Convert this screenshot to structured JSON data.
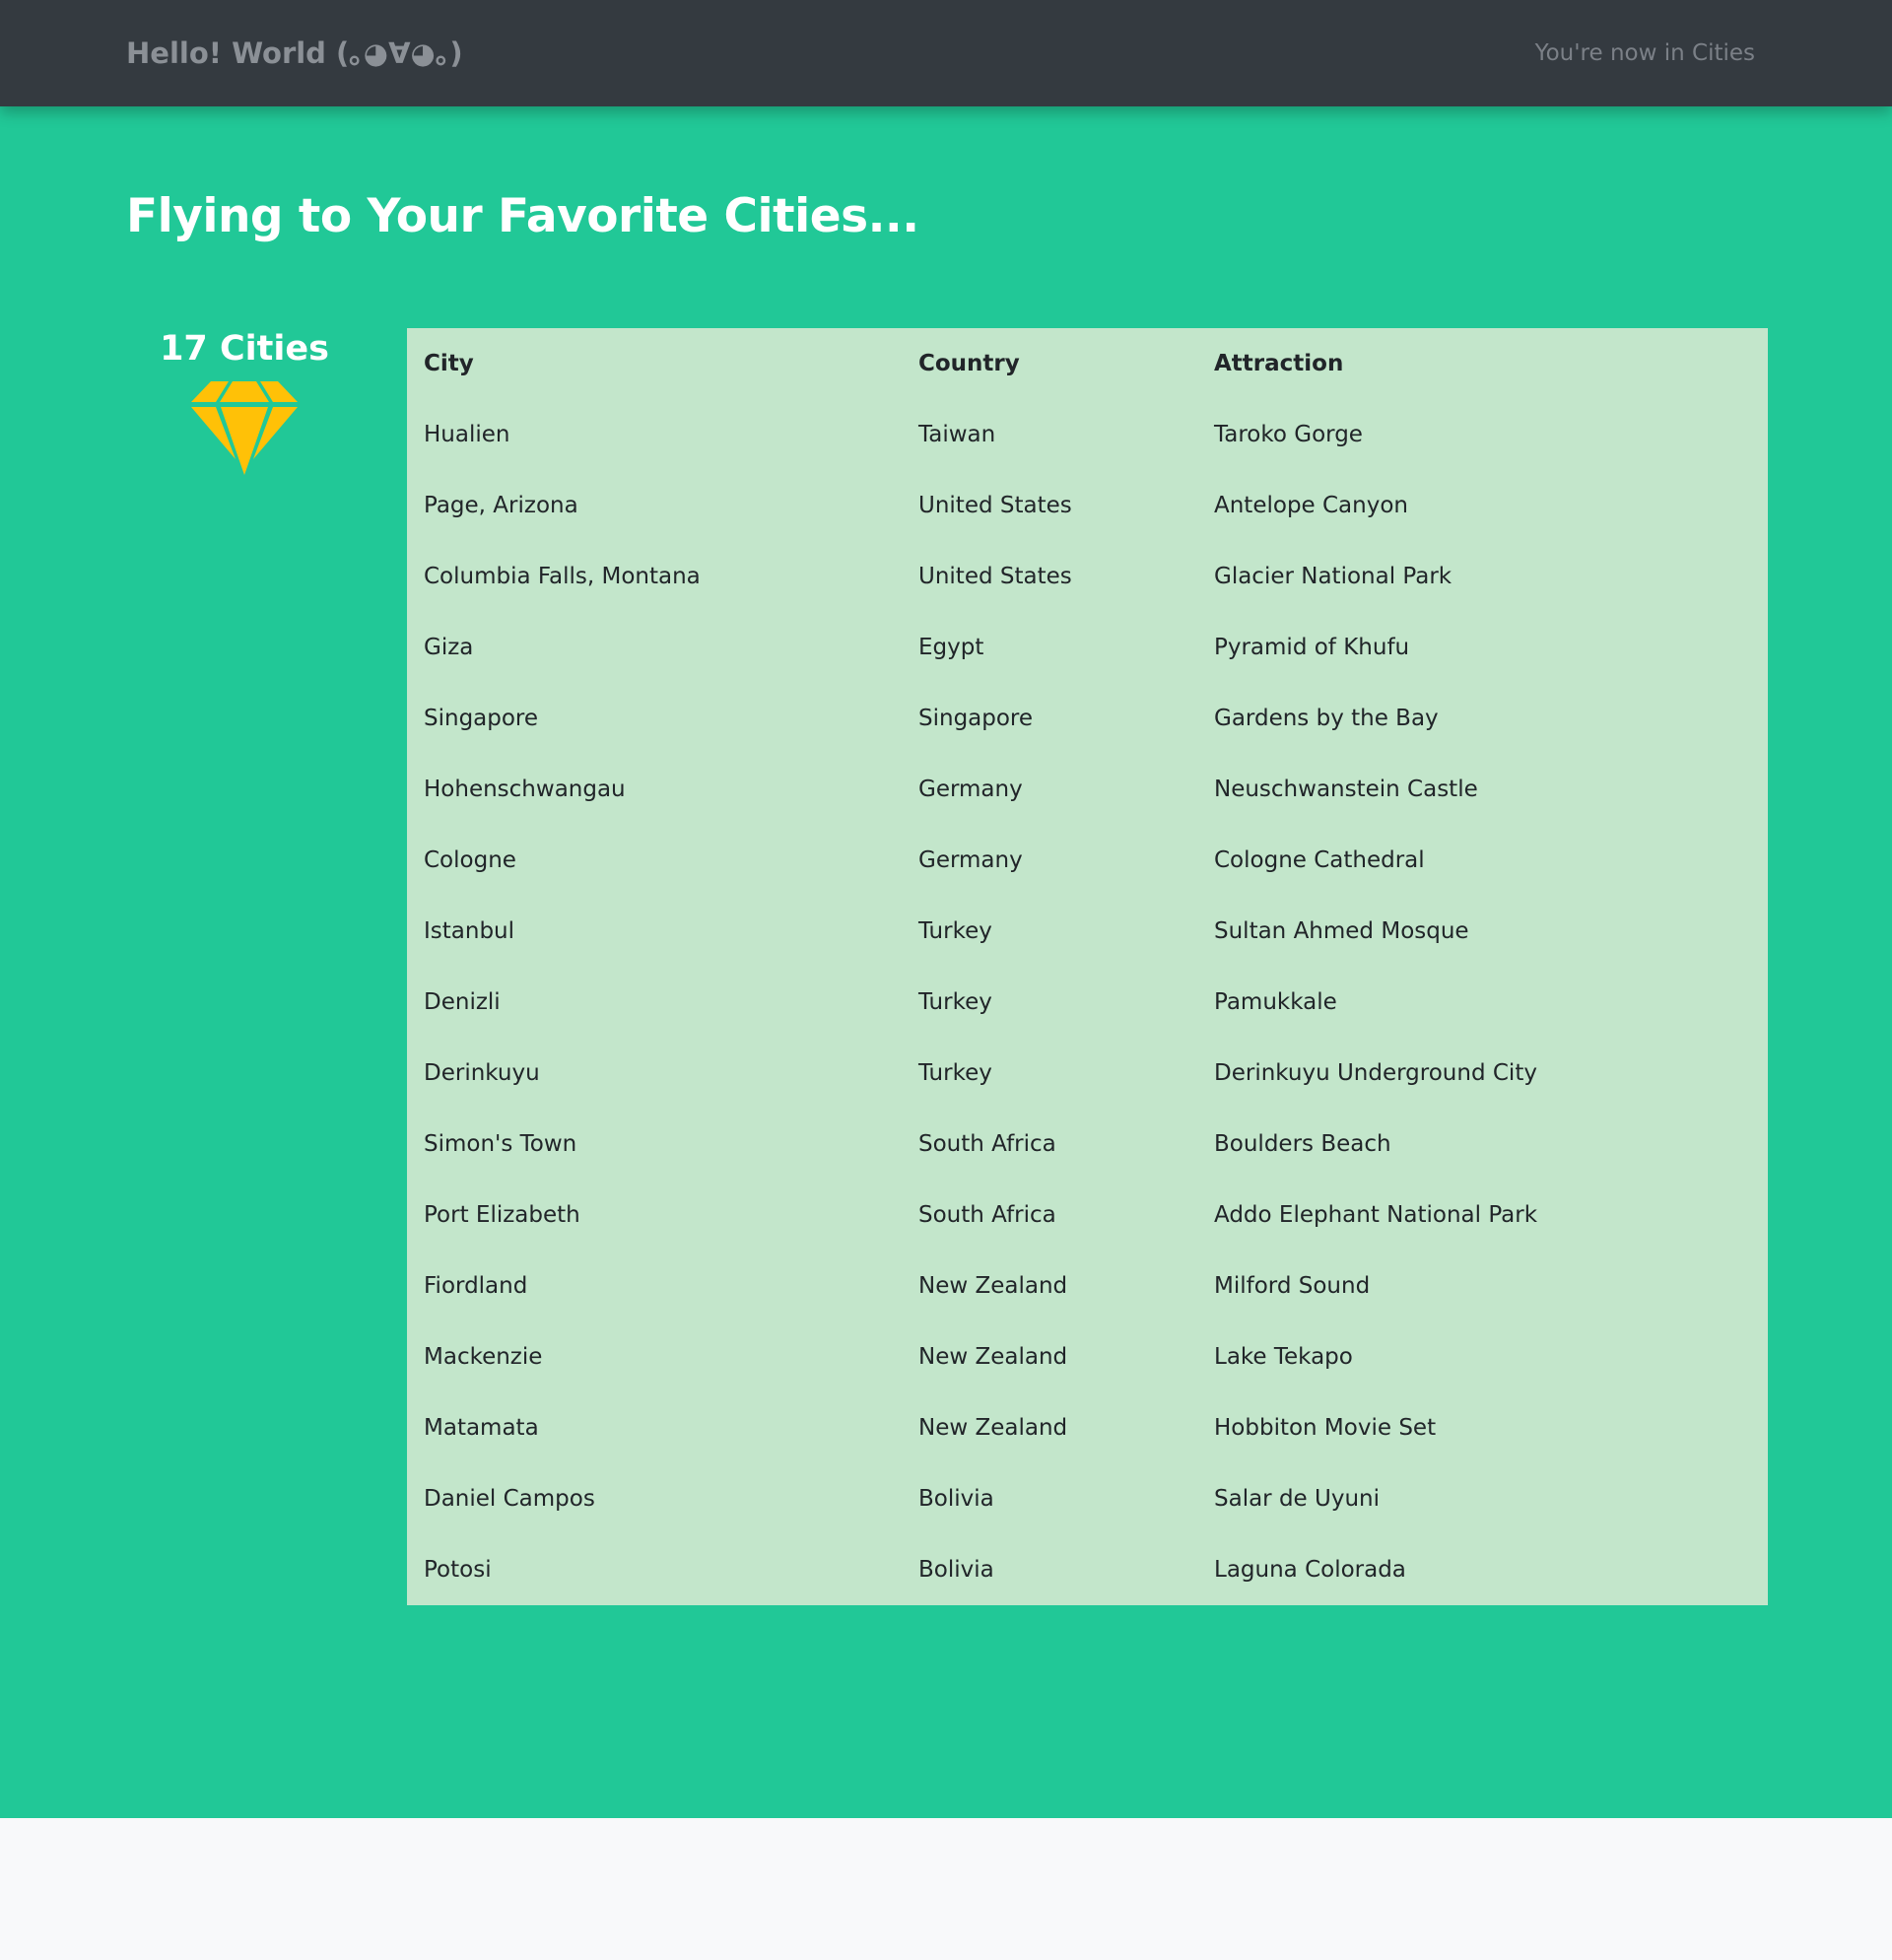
{
  "navbar": {
    "brand": "Hello! World (｡◕∀◕｡)",
    "status": "You're now in Cities"
  },
  "hero": {
    "title": "Flying to Your Favorite Cities...",
    "count_label": "17 Cities",
    "icon": "diamond-icon",
    "colors": {
      "background": "#21c897",
      "table": "#c3e6cb",
      "icon": "#ffc107",
      "navbar": "#343a40"
    }
  },
  "table": {
    "headers": [
      "City",
      "Country",
      "Attraction"
    ],
    "rows": [
      [
        "Hualien",
        "Taiwan",
        "Taroko Gorge"
      ],
      [
        "Page, Arizona",
        "United States",
        "Antelope Canyon"
      ],
      [
        "Columbia Falls, Montana",
        "United States",
        "Glacier National Park"
      ],
      [
        "Giza",
        "Egypt",
        "Pyramid of Khufu"
      ],
      [
        "Singapore",
        "Singapore",
        "Gardens by the Bay"
      ],
      [
        "Hohenschwangau",
        "Germany",
        "Neuschwanstein Castle"
      ],
      [
        "Cologne",
        "Germany",
        "Cologne Cathedral"
      ],
      [
        "Istanbul",
        "Turkey",
        "Sultan Ahmed Mosque"
      ],
      [
        "Denizli",
        "Turkey",
        "Pamukkale"
      ],
      [
        "Derinkuyu",
        "Turkey",
        "Derinkuyu Underground City"
      ],
      [
        "Simon's Town",
        "South Africa",
        "Boulders Beach"
      ],
      [
        "Port Elizabeth",
        "South Africa",
        "Addo Elephant National Park"
      ],
      [
        "Fiordland",
        "New Zealand",
        "Milford Sound"
      ],
      [
        "Mackenzie",
        "New Zealand",
        "Lake Tekapo"
      ],
      [
        "Matamata",
        "New Zealand",
        "Hobbiton Movie Set"
      ],
      [
        "Daniel Campos",
        "Bolivia",
        "Salar de Uyuni"
      ],
      [
        "Potosi",
        "Bolivia",
        "Laguna Colorada"
      ]
    ]
  }
}
